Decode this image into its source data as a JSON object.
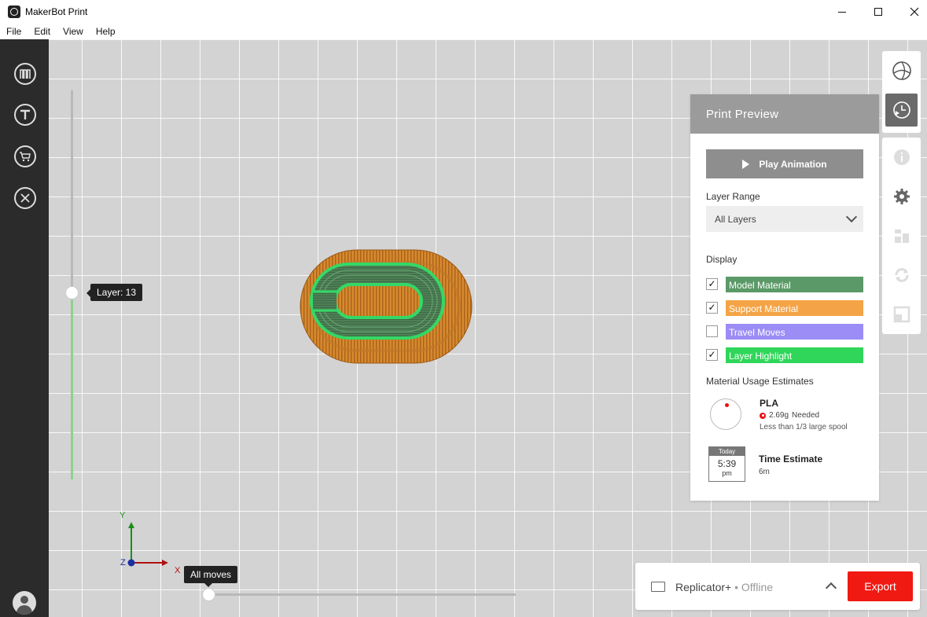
{
  "window": {
    "title": "MakerBot Print"
  },
  "menu": [
    "File",
    "Edit",
    "View",
    "Help"
  ],
  "sidebar": {
    "items": [
      {
        "icon": "makerbot-logo-icon",
        "glyph": "M"
      },
      {
        "icon": "thingiverse-icon",
        "glyph": "T"
      },
      {
        "icon": "store-cart-icon",
        "glyph": ""
      },
      {
        "icon": "utilities-tools-icon",
        "glyph": ""
      }
    ]
  },
  "viewport": {
    "layer_slider": {
      "label": "Layer: 13"
    },
    "moves_slider": {
      "label": "All moves"
    },
    "axes": {
      "x": "X",
      "y": "Y",
      "z": "Z"
    }
  },
  "print_preview": {
    "title": "Print Preview",
    "play_label": "Play Animation",
    "layer_range_label": "Layer Range",
    "layer_range_value": "All Layers",
    "display_label": "Display",
    "display_items": [
      {
        "label": "Model Material",
        "checked": true,
        "color": "#5b9a68"
      },
      {
        "label": "Support Material",
        "checked": true,
        "color": "#f4a446"
      },
      {
        "label": "Travel Moves",
        "checked": false,
        "color": "#9c8cf6"
      },
      {
        "label": "Layer Highlight",
        "checked": true,
        "color": "#2fd65a"
      }
    ],
    "usage_label": "Material Usage Estimates",
    "material": {
      "name": "PLA",
      "amount": "2.69g",
      "needed": "Needed",
      "spool_text": "Less than 1/3 large spool"
    },
    "clock": {
      "header": "Today",
      "time": "5:39",
      "ampm": "pm"
    },
    "time_estimate_label": "Time Estimate",
    "time_estimate_value": "6m"
  },
  "printer": {
    "name": "Replicator+",
    "status": " • Offline",
    "export_label": "Export"
  }
}
